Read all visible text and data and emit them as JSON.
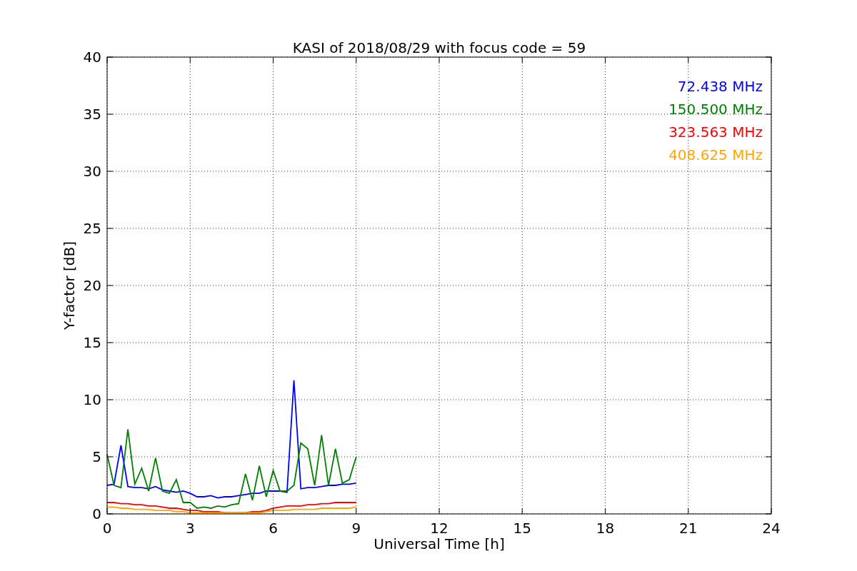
{
  "chart_data": {
    "type": "line",
    "title": "KASI of 2018/08/29 with focus code = 59",
    "xlabel": "Universal Time [h]",
    "ylabel": "Y-factor [dB]",
    "xlim": [
      0,
      24
    ],
    "ylim": [
      0,
      40
    ],
    "xticks": [
      0,
      3,
      6,
      9,
      12,
      15,
      18,
      21,
      24
    ],
    "yticks": [
      0,
      5,
      10,
      15,
      20,
      25,
      30,
      35,
      40
    ],
    "grid": true,
    "x": [
      0,
      0.25,
      0.5,
      0.75,
      1,
      1.25,
      1.5,
      1.75,
      2,
      2.25,
      2.5,
      2.75,
      3,
      3.25,
      3.5,
      3.75,
      4,
      4.25,
      4.5,
      4.75,
      5,
      5.25,
      5.5,
      5.75,
      6,
      6.25,
      6.5,
      6.75,
      7,
      7.25,
      7.5,
      7.75,
      8,
      8.25,
      8.5,
      8.75,
      9
    ],
    "series": [
      {
        "name": "72.438 MHz",
        "color": "#0000ff",
        "values": [
          2.5,
          2.6,
          6.0,
          2.4,
          2.3,
          2.3,
          2.2,
          2.4,
          2.1,
          2.0,
          1.9,
          2.0,
          1.8,
          1.5,
          1.5,
          1.6,
          1.4,
          1.5,
          1.5,
          1.6,
          1.7,
          1.8,
          1.8,
          2.0,
          2.0,
          2.0,
          1.9,
          11.7,
          2.2,
          2.3,
          2.3,
          2.4,
          2.5,
          2.5,
          2.6,
          2.6,
          2.7
        ]
      },
      {
        "name": "150.500 MHz",
        "color": "#008000",
        "values": [
          5.2,
          2.5,
          2.3,
          7.4,
          2.6,
          4.0,
          2.0,
          4.9,
          2.0,
          1.8,
          3.0,
          1.0,
          1.0,
          0.5,
          0.6,
          0.5,
          0.7,
          0.6,
          0.8,
          0.9,
          3.5,
          1.2,
          4.2,
          1.5,
          3.8,
          2.0,
          2.0,
          2.5,
          6.2,
          5.7,
          2.5,
          6.9,
          2.5,
          5.7,
          2.7,
          3.0,
          5.0
        ]
      },
      {
        "name": "323.563 MHz",
        "color": "#ff0000",
        "values": [
          1.0,
          1.0,
          0.9,
          0.9,
          0.8,
          0.8,
          0.7,
          0.7,
          0.6,
          0.5,
          0.5,
          0.4,
          0.3,
          0.3,
          0.2,
          0.2,
          0.2,
          0.1,
          0.1,
          0.1,
          0.1,
          0.2,
          0.2,
          0.3,
          0.5,
          0.6,
          0.7,
          0.7,
          0.7,
          0.8,
          0.8,
          0.9,
          0.9,
          1.0,
          1.0,
          1.0,
          1.0
        ]
      },
      {
        "name": "408.625 MHz",
        "color": "#ffa500",
        "values": [
          0.6,
          0.6,
          0.5,
          0.5,
          0.4,
          0.4,
          0.4,
          0.3,
          0.3,
          0.3,
          0.2,
          0.2,
          0.1,
          0.1,
          0.1,
          0.1,
          0.1,
          0.1,
          0.1,
          0.1,
          0.1,
          0.1,
          0.1,
          0.2,
          0.3,
          0.3,
          0.3,
          0.4,
          0.4,
          0.4,
          0.4,
          0.5,
          0.5,
          0.5,
          0.5,
          0.5,
          0.6
        ]
      }
    ]
  }
}
